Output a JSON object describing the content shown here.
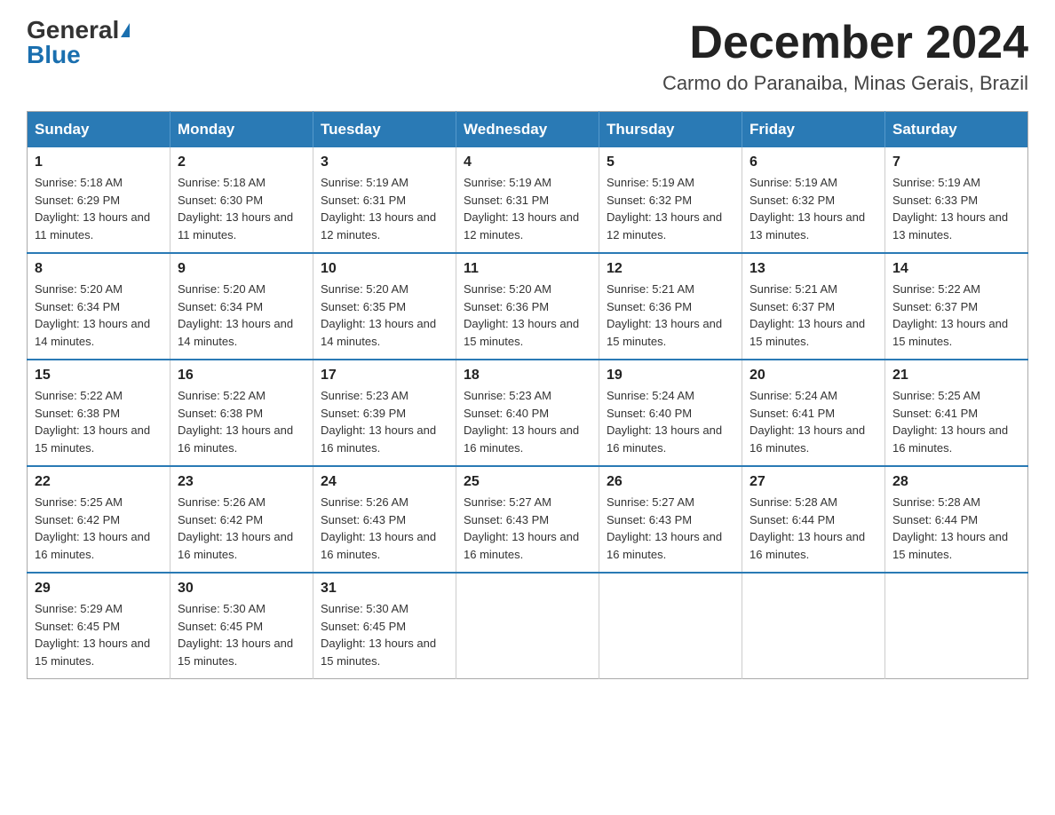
{
  "logo": {
    "general": "General",
    "blue": "Blue"
  },
  "header": {
    "month": "December 2024",
    "location": "Carmo do Paranaiba, Minas Gerais, Brazil"
  },
  "days_of_week": [
    "Sunday",
    "Monday",
    "Tuesday",
    "Wednesday",
    "Thursday",
    "Friday",
    "Saturday"
  ],
  "weeks": [
    [
      {
        "day": "1",
        "sunrise": "5:18 AM",
        "sunset": "6:29 PM",
        "daylight": "13 hours and 11 minutes."
      },
      {
        "day": "2",
        "sunrise": "5:18 AM",
        "sunset": "6:30 PM",
        "daylight": "13 hours and 11 minutes."
      },
      {
        "day": "3",
        "sunrise": "5:19 AM",
        "sunset": "6:31 PM",
        "daylight": "13 hours and 12 minutes."
      },
      {
        "day": "4",
        "sunrise": "5:19 AM",
        "sunset": "6:31 PM",
        "daylight": "13 hours and 12 minutes."
      },
      {
        "day": "5",
        "sunrise": "5:19 AM",
        "sunset": "6:32 PM",
        "daylight": "13 hours and 12 minutes."
      },
      {
        "day": "6",
        "sunrise": "5:19 AM",
        "sunset": "6:32 PM",
        "daylight": "13 hours and 13 minutes."
      },
      {
        "day": "7",
        "sunrise": "5:19 AM",
        "sunset": "6:33 PM",
        "daylight": "13 hours and 13 minutes."
      }
    ],
    [
      {
        "day": "8",
        "sunrise": "5:20 AM",
        "sunset": "6:34 PM",
        "daylight": "13 hours and 14 minutes."
      },
      {
        "day": "9",
        "sunrise": "5:20 AM",
        "sunset": "6:34 PM",
        "daylight": "13 hours and 14 minutes."
      },
      {
        "day": "10",
        "sunrise": "5:20 AM",
        "sunset": "6:35 PM",
        "daylight": "13 hours and 14 minutes."
      },
      {
        "day": "11",
        "sunrise": "5:20 AM",
        "sunset": "6:36 PM",
        "daylight": "13 hours and 15 minutes."
      },
      {
        "day": "12",
        "sunrise": "5:21 AM",
        "sunset": "6:36 PM",
        "daylight": "13 hours and 15 minutes."
      },
      {
        "day": "13",
        "sunrise": "5:21 AM",
        "sunset": "6:37 PM",
        "daylight": "13 hours and 15 minutes."
      },
      {
        "day": "14",
        "sunrise": "5:22 AM",
        "sunset": "6:37 PM",
        "daylight": "13 hours and 15 minutes."
      }
    ],
    [
      {
        "day": "15",
        "sunrise": "5:22 AM",
        "sunset": "6:38 PM",
        "daylight": "13 hours and 15 minutes."
      },
      {
        "day": "16",
        "sunrise": "5:22 AM",
        "sunset": "6:38 PM",
        "daylight": "13 hours and 16 minutes."
      },
      {
        "day": "17",
        "sunrise": "5:23 AM",
        "sunset": "6:39 PM",
        "daylight": "13 hours and 16 minutes."
      },
      {
        "day": "18",
        "sunrise": "5:23 AM",
        "sunset": "6:40 PM",
        "daylight": "13 hours and 16 minutes."
      },
      {
        "day": "19",
        "sunrise": "5:24 AM",
        "sunset": "6:40 PM",
        "daylight": "13 hours and 16 minutes."
      },
      {
        "day": "20",
        "sunrise": "5:24 AM",
        "sunset": "6:41 PM",
        "daylight": "13 hours and 16 minutes."
      },
      {
        "day": "21",
        "sunrise": "5:25 AM",
        "sunset": "6:41 PM",
        "daylight": "13 hours and 16 minutes."
      }
    ],
    [
      {
        "day": "22",
        "sunrise": "5:25 AM",
        "sunset": "6:42 PM",
        "daylight": "13 hours and 16 minutes."
      },
      {
        "day": "23",
        "sunrise": "5:26 AM",
        "sunset": "6:42 PM",
        "daylight": "13 hours and 16 minutes."
      },
      {
        "day": "24",
        "sunrise": "5:26 AM",
        "sunset": "6:43 PM",
        "daylight": "13 hours and 16 minutes."
      },
      {
        "day": "25",
        "sunrise": "5:27 AM",
        "sunset": "6:43 PM",
        "daylight": "13 hours and 16 minutes."
      },
      {
        "day": "26",
        "sunrise": "5:27 AM",
        "sunset": "6:43 PM",
        "daylight": "13 hours and 16 minutes."
      },
      {
        "day": "27",
        "sunrise": "5:28 AM",
        "sunset": "6:44 PM",
        "daylight": "13 hours and 16 minutes."
      },
      {
        "day": "28",
        "sunrise": "5:28 AM",
        "sunset": "6:44 PM",
        "daylight": "13 hours and 15 minutes."
      }
    ],
    [
      {
        "day": "29",
        "sunrise": "5:29 AM",
        "sunset": "6:45 PM",
        "daylight": "13 hours and 15 minutes."
      },
      {
        "day": "30",
        "sunrise": "5:30 AM",
        "sunset": "6:45 PM",
        "daylight": "13 hours and 15 minutes."
      },
      {
        "day": "31",
        "sunrise": "5:30 AM",
        "sunset": "6:45 PM",
        "daylight": "13 hours and 15 minutes."
      },
      null,
      null,
      null,
      null
    ]
  ]
}
